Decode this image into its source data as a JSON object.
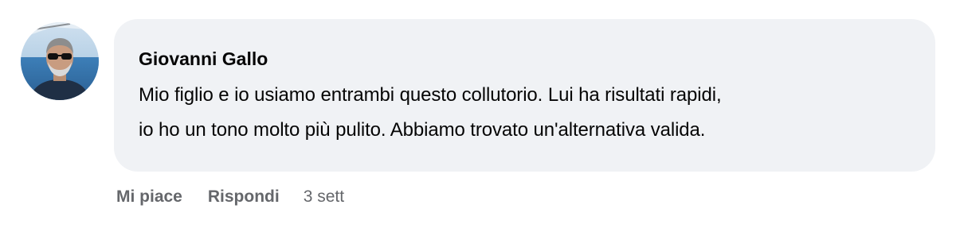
{
  "comment": {
    "author": "Giovanni Gallo",
    "text_lines": [
      "Mio figlio e io usiamo entrambi questo collutorio. Lui ha risultati rapidi,",
      "io ho un tono molto più pulito. Abbiamo trovato un'alternativa valida."
    ],
    "actions": {
      "like": "Mi piace",
      "reply": "Rispondi",
      "time": "3 sett"
    }
  },
  "colors": {
    "bubble": "#f0f2f5",
    "text": "#050505",
    "meta": "#65676b"
  }
}
